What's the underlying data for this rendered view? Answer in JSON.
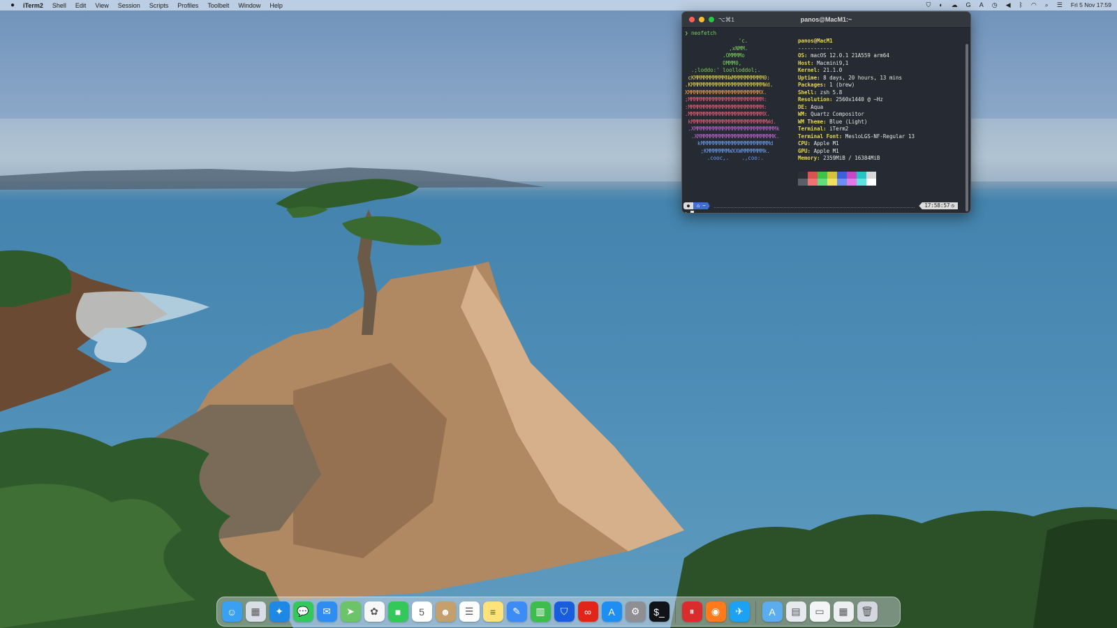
{
  "menubar": {
    "app_name": "iTerm2",
    "menus": [
      "Shell",
      "Edit",
      "View",
      "Session",
      "Scripts",
      "Profiles",
      "Toolbelt",
      "Window",
      "Help"
    ],
    "status_icons": [
      "shield-icon",
      "toggle-icon",
      "cloud-icon",
      "grammar-icon",
      "text-input-icon",
      "time-machine-icon",
      "volume-icon",
      "bluetooth-icon",
      "wifi-icon",
      "spotlight-icon",
      "control-center-icon"
    ],
    "clock": "Fri 5 Nov  17:59"
  },
  "terminal": {
    "tab_shortcut": "⌥⌘1",
    "title": "panos@MacM1:~",
    "command": "❯ neofetch",
    "logo_lines": [
      {
        "text": "                 'c.",
        "color": "g"
      },
      {
        "text": "              ,xNMM.",
        "color": "g"
      },
      {
        "text": "            .OMMMMo",
        "color": "g"
      },
      {
        "text": "            OMMM0,",
        "color": "g"
      },
      {
        "text": "  .;loddo:' loolloddol;.",
        "color": "g"
      },
      {
        "text": " cKMMMMMMMMMMNWMMMMMMMMMM0:",
        "color": "y"
      },
      {
        "text": ".KMMMMMMMMMMMMMMMMMMMMMMMWd.",
        "color": "y"
      },
      {
        "text": "XMMMMMMMMMMMMMMMMMMMMMMMX.",
        "color": "o"
      },
      {
        "text": ";MMMMMMMMMMMMMMMMMMMMMMMM:",
        "color": "r"
      },
      {
        "text": ":MMMMMMMMMMMMMMMMMMMMMMMM:",
        "color": "r"
      },
      {
        "text": ".MMMMMMMMMMMMMMMMMMMMMMMMX.",
        "color": "r"
      },
      {
        "text": " kMMMMMMMMMMMMMMMMMMMMMMMMWd.",
        "color": "r"
      },
      {
        "text": " .XMMMMMMMMMMMMMMMMMMMMMMMMMMk",
        "color": "p"
      },
      {
        "text": "  .XMMMMMMMMMMMMMMMMMMMMMMMMK.",
        "color": "p"
      },
      {
        "text": "    kMMMMMMMMMMMMMMMMMMMMMMd",
        "color": "b"
      },
      {
        "text": "     ;KMMMMMMMWXXWMMMMMMMk.",
        "color": "b"
      },
      {
        "text": "       .cooc,.    .,coo:.",
        "color": "b"
      }
    ],
    "user_host": "panos@MacM1",
    "separator": "-----------",
    "info": [
      {
        "key": "OS",
        "value": "macOS 12.0.1 21A559 arm64"
      },
      {
        "key": "Host",
        "value": "Macmini9,1"
      },
      {
        "key": "Kernel",
        "value": "21.1.0"
      },
      {
        "key": "Uptime",
        "value": "8 days, 20 hours, 13 mins"
      },
      {
        "key": "Packages",
        "value": "1 (brew)"
      },
      {
        "key": "Shell",
        "value": "zsh 5.8"
      },
      {
        "key": "Resolution",
        "value": "2560x1440 @ ~Hz"
      },
      {
        "key": "DE",
        "value": "Aqua"
      },
      {
        "key": "WM",
        "value": "Quartz Compositor"
      },
      {
        "key": "WM Theme",
        "value": "Blue (Light)"
      },
      {
        "key": "Terminal",
        "value": "iTerm2"
      },
      {
        "key": "Terminal Font",
        "value": "MesloLGS-NF-Regular 13"
      },
      {
        "key": "CPU",
        "value": "Apple M1"
      },
      {
        "key": "GPU",
        "value": "Apple M1"
      },
      {
        "key": "Memory",
        "value": "2359MiB / 16384MiB"
      }
    ],
    "palette_top": [
      "#2b2f36",
      "#d9534f",
      "#3cc34a",
      "#d4c23a",
      "#3c60d8",
      "#c548c9",
      "#2ac3c3",
      "#d8d8d8"
    ],
    "palette_bottom": [
      "#5a5e66",
      "#f07272",
      "#5fe07a",
      "#f0e060",
      "#6d8ff5",
      "#e07ae6",
      "#5ee3e3",
      "#ffffff"
    ],
    "prompt_dir": "⌂ ~",
    "prompt_time": "17:58:57",
    "prompt_char": "❯"
  },
  "dock": {
    "apps": [
      {
        "name": "finder",
        "color": "#3aa0f2",
        "glyph": "☺",
        "running": true
      },
      {
        "name": "launchpad",
        "color": "#d8dde6",
        "glyph": "▦",
        "running": false
      },
      {
        "name": "safari",
        "color": "#1e88e5",
        "glyph": "✦",
        "running": true
      },
      {
        "name": "messages",
        "color": "#34c759",
        "glyph": "💬",
        "running": false
      },
      {
        "name": "mail",
        "color": "#2f8cf0",
        "glyph": "✉",
        "running": true
      },
      {
        "name": "maps",
        "color": "#6cc36a",
        "glyph": "➤",
        "running": false
      },
      {
        "name": "photos",
        "color": "#f7f7f7",
        "glyph": "✿",
        "running": false
      },
      {
        "name": "facetime",
        "color": "#34c759",
        "glyph": "■",
        "running": false
      },
      {
        "name": "calendar",
        "color": "#ffffff",
        "glyph": "5",
        "running": false
      },
      {
        "name": "contacts",
        "color": "#c6a06c",
        "glyph": "☻",
        "running": false
      },
      {
        "name": "reminders",
        "color": "#ffffff",
        "glyph": "☰",
        "running": false
      },
      {
        "name": "notes",
        "color": "#ffe27a",
        "glyph": "≡",
        "running": false
      },
      {
        "name": "pages",
        "color": "#3d8cf5",
        "glyph": "✎",
        "running": false
      },
      {
        "name": "numbers",
        "color": "#3ebd4f",
        "glyph": "▥",
        "running": false
      },
      {
        "name": "bitwarden",
        "color": "#175ddc",
        "glyph": "⛉",
        "running": false
      },
      {
        "name": "creative-cloud",
        "color": "#e1251b",
        "glyph": "∞",
        "running": false
      },
      {
        "name": "app-store",
        "color": "#1e8ef3",
        "glyph": "A",
        "running": false
      },
      {
        "name": "system-preferences",
        "color": "#8e8e93",
        "glyph": "⚙",
        "running": false
      },
      {
        "name": "iterm2",
        "color": "#101418",
        "glyph": "$_",
        "running": true
      }
    ],
    "extra_apps": [
      {
        "name": "parallels",
        "color": "#d92d2d",
        "glyph": "⏸",
        "running": true
      },
      {
        "name": "firefox",
        "color": "#ff7a1a",
        "glyph": "◉",
        "running": true
      },
      {
        "name": "twitter",
        "color": "#1da1f2",
        "glyph": "✈",
        "running": false
      }
    ],
    "stacks": [
      {
        "name": "applications-folder",
        "color": "#5aaef0",
        "glyph": "A"
      },
      {
        "name": "downloads-stack",
        "color": "#e6e9ee",
        "glyph": "▤"
      },
      {
        "name": "documents-stack",
        "color": "#f3f4f6",
        "glyph": "▭"
      },
      {
        "name": "screenshots-stack",
        "color": "#eceef1",
        "glyph": "▦"
      },
      {
        "name": "trash",
        "color": "#d4d8de",
        "glyph": "🗑"
      }
    ]
  }
}
